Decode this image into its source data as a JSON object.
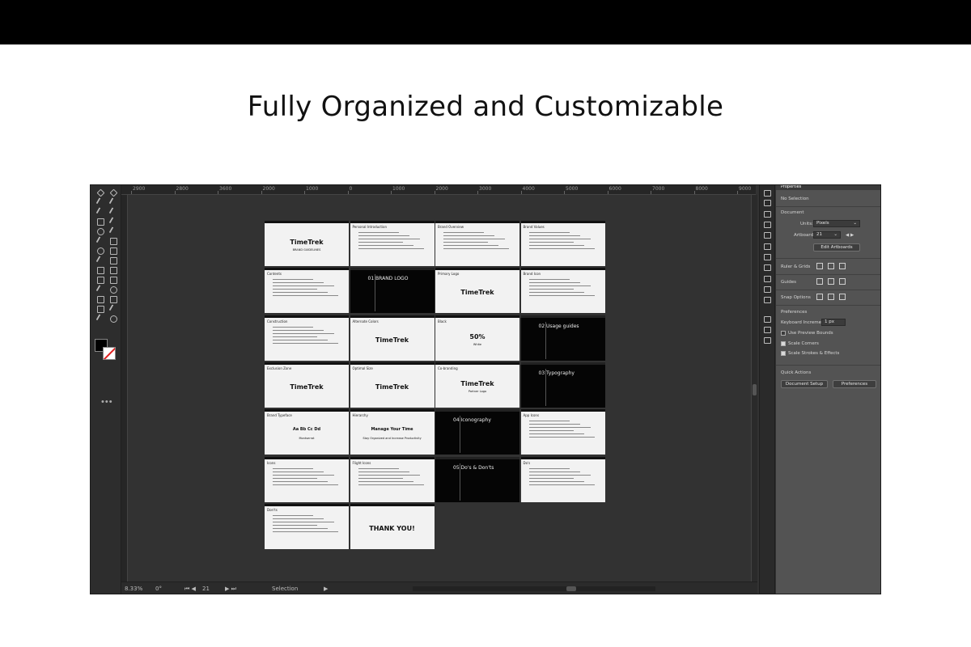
{
  "headline": "Fully Organized and Customizable",
  "ruler": {
    "ticks": [
      "2900",
      "2800",
      "3600",
      "2000",
      "1000",
      "0",
      "1000",
      "2000",
      "3000",
      "4000",
      "5000",
      "6000",
      "7000",
      "8000",
      "9000",
      "10000"
    ]
  },
  "artboards": [
    {
      "title": "",
      "big": "TimeTrek",
      "sub": "BRAND GUIDELINES",
      "dark": false
    },
    {
      "title": "Personal Introduction",
      "big": "",
      "sub": "",
      "dark": false
    },
    {
      "title": "Brand Overview",
      "big": "",
      "sub": "",
      "dark": false
    },
    {
      "title": "Brand Values",
      "big": "",
      "sub": "",
      "dark": false
    },
    {
      "title": "Contents",
      "big": "",
      "sub": "",
      "dark": false
    },
    {
      "title": "",
      "big": "01 BRAND LOGO",
      "sub": "",
      "dark": true
    },
    {
      "title": "Primary Logo",
      "big": "TimeTrek",
      "sub": "",
      "dark": false
    },
    {
      "title": "Brand Icon",
      "big": "",
      "sub": "",
      "dark": false
    },
    {
      "title": "Construction",
      "big": "",
      "sub": "",
      "dark": false
    },
    {
      "title": "Alternate Colors",
      "big": "TimeTrek",
      "sub": "",
      "dark": false
    },
    {
      "title": "Black",
      "big": "50%",
      "sub": "White",
      "dark": false
    },
    {
      "title": "",
      "big": "02 Usage guides",
      "sub": "",
      "dark": true
    },
    {
      "title": "Exclusion Zone",
      "big": "TimeTrek",
      "sub": "",
      "dark": false
    },
    {
      "title": "Optimal Size",
      "big": "TimeTrek",
      "sub": "",
      "dark": false
    },
    {
      "title": "Co-branding",
      "big": "TimeTrek",
      "sub": "Partner Logo",
      "dark": false
    },
    {
      "title": "",
      "big": "03 Typography",
      "sub": "",
      "dark": true
    },
    {
      "title": "Brand Typeface",
      "big": "Aa Bb Cc Dd",
      "sub": "Montserrat",
      "dark": false
    },
    {
      "title": "Hierarchy",
      "big": "Manage Your Time",
      "sub": "Stay Organized and Increase Productivity",
      "dark": false
    },
    {
      "title": "",
      "big": "04 Iconography",
      "sub": "",
      "dark": true
    },
    {
      "title": "App Icons",
      "big": "",
      "sub": "",
      "dark": false
    },
    {
      "title": "Icons",
      "big": "",
      "sub": "",
      "dark": false
    },
    {
      "title": "Flight Icons",
      "big": "",
      "sub": "",
      "dark": false
    },
    {
      "title": "",
      "big": "05 Do's & Don'ts",
      "sub": "",
      "dark": true
    },
    {
      "title": "Do's",
      "big": "",
      "sub": "",
      "dark": false
    },
    {
      "title": "Don'ts",
      "big": "",
      "sub": "",
      "dark": false
    },
    {
      "title": "",
      "big": "THANK YOU!",
      "sub": "",
      "dark": false
    }
  ],
  "status": {
    "zoom": "8.33%",
    "rotate": "0°",
    "artboard_num": "21",
    "tool": "Selection"
  },
  "panel": {
    "tab": "Properties",
    "selection": "No Selection",
    "document_label": "Document",
    "units_label": "Units:",
    "units_value": "Pixels",
    "artboard_label": "Artboard:",
    "artboard_value": "21",
    "edit_artboards": "Edit Artboards",
    "rulers_label": "Ruler & Grids",
    "guides_label": "Guides",
    "snap_label": "Snap Options",
    "prefs_label": "Preferences",
    "keyboard_label": "Keyboard Increment:",
    "keyboard_value": "1 px",
    "use_preview": "Use Preview Bounds",
    "scale_corners": "Scale Corners",
    "scale_strokes": "Scale Strokes & Effects",
    "quick_actions": "Quick Actions",
    "document_setup": "Document Setup",
    "preferences_btn": "Preferences"
  }
}
